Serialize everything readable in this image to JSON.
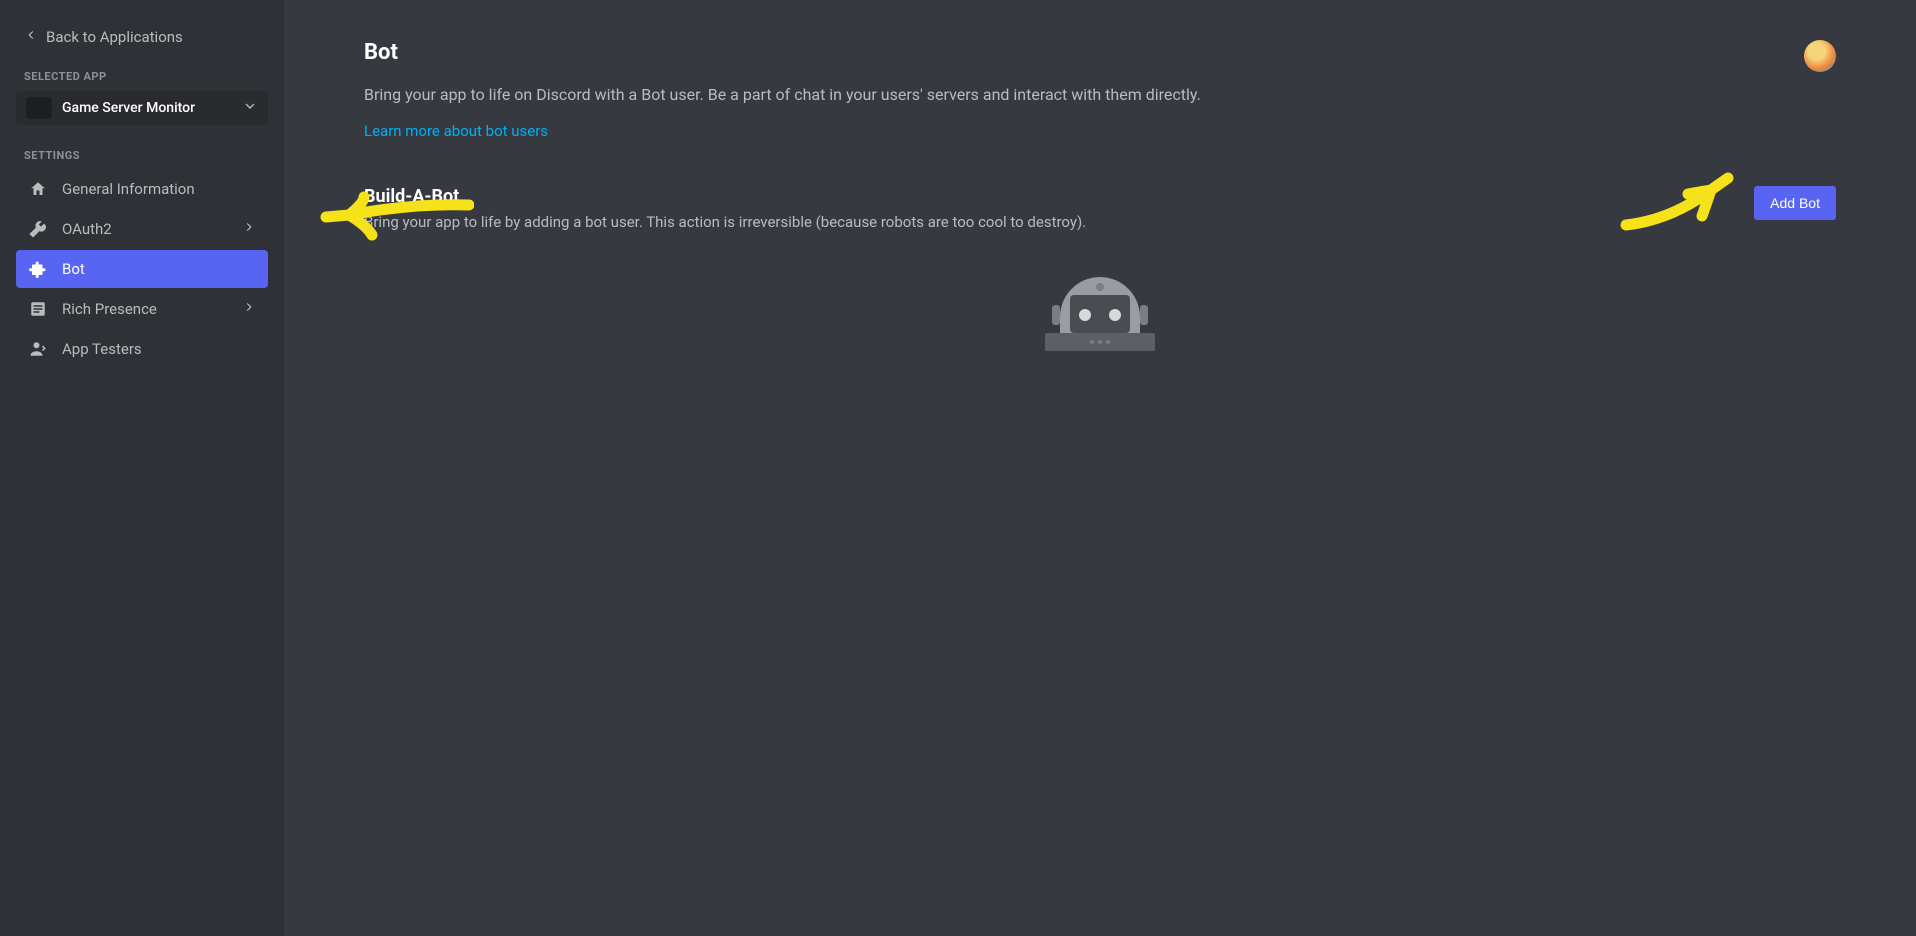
{
  "sidebar": {
    "back_label": "Back to Applications",
    "selected_app_label": "SELECTED APP",
    "app_name": "Game Server Monitor",
    "settings_label": "SETTINGS",
    "items": [
      {
        "label": "General Information",
        "icon": "home-icon",
        "has_sub": false,
        "active": false
      },
      {
        "label": "OAuth2",
        "icon": "wrench-icon",
        "has_sub": true,
        "active": false
      },
      {
        "label": "Bot",
        "icon": "puzzle-icon",
        "has_sub": false,
        "active": true
      },
      {
        "label": "Rich Presence",
        "icon": "list-icon",
        "has_sub": true,
        "active": false
      },
      {
        "label": "App Testers",
        "icon": "person-icon",
        "has_sub": false,
        "active": false
      }
    ]
  },
  "main": {
    "title": "Bot",
    "description": "Bring your app to life on Discord with a Bot user. Be a part of chat in your users' servers and interact with them directly.",
    "learn_more": "Learn more about bot users",
    "build": {
      "title": "Build-A-Bot",
      "description": "Bring your app to life by adding a bot user. This action is irreversible (because robots are too cool to destroy).",
      "button": "Add Bot"
    }
  },
  "colors": {
    "accent": "#5865f2",
    "link": "#00aff4",
    "bg_main": "#36393f",
    "bg_sidebar": "#2f3136"
  }
}
